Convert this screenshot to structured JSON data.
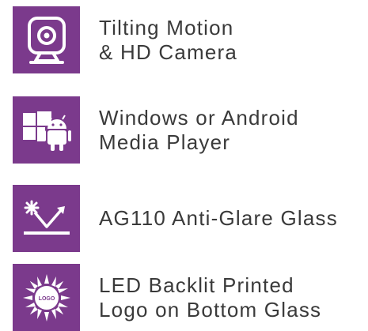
{
  "theme": {
    "tile_color": "#7b3a8c",
    "text_color": "#3a3a3a"
  },
  "features": [
    {
      "icon": "webcam-icon",
      "lines": [
        "Tilting Motion",
        "& HD Camera"
      ]
    },
    {
      "icon": "windows-android-icon",
      "lines": [
        "Windows or Android",
        "Media Player"
      ]
    },
    {
      "icon": "anti-glare-icon",
      "lines": [
        "AG110 Anti-Glare Glass"
      ]
    },
    {
      "icon": "backlit-logo-icon",
      "lines": [
        "LED Backlit Printed",
        "Logo on Bottom Glass"
      ],
      "icon_text": "LOGO"
    }
  ]
}
